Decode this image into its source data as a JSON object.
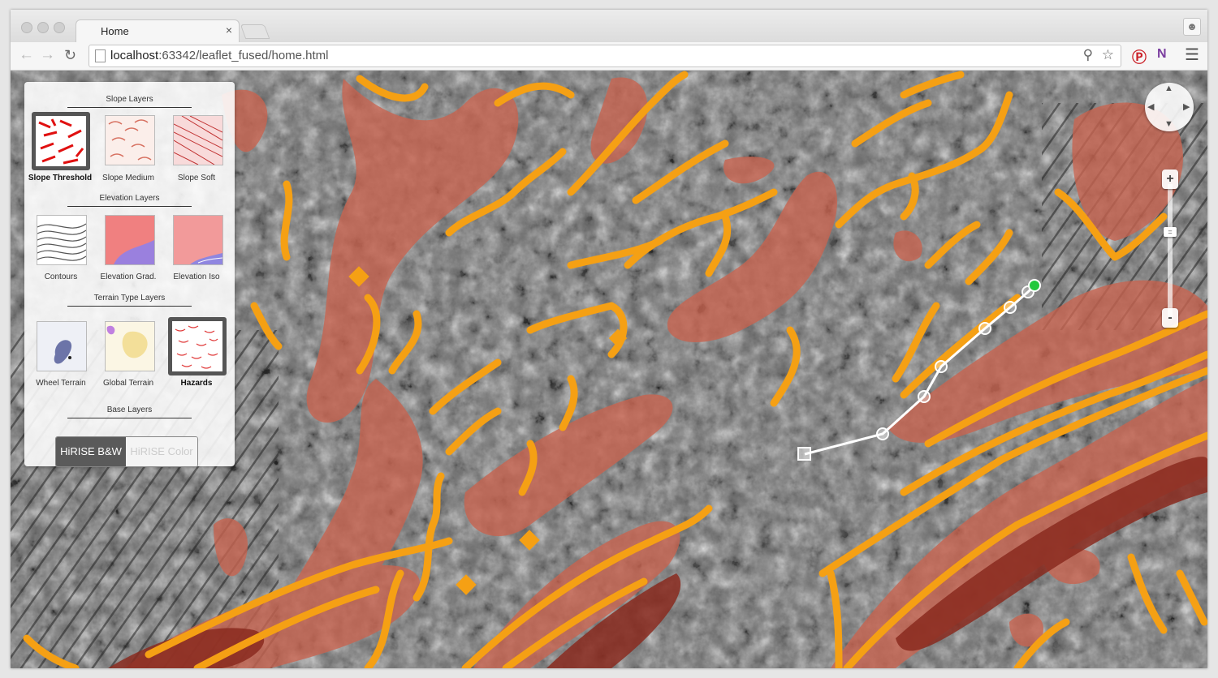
{
  "browser": {
    "tab_title": "Home",
    "tab_close": "×",
    "url_host": "localhost",
    "url_rest": ":63342/leaflet_fused/home.html"
  },
  "icons": {
    "back": "back-arrow-icon",
    "forward": "forward-arrow-icon",
    "reload": "reload-icon",
    "zoom_page": "magnifier-icon",
    "bookmark": "star-icon",
    "pinterest": "pinterest-icon",
    "onenote": "onenote-icon",
    "menu": "hamburger-menu-icon",
    "profile": "person-icon"
  },
  "layer_panel": {
    "sections": {
      "slope": "Slope Layers",
      "elevation": "Elevation Layers",
      "terrain": "Terrain Type Layers",
      "base": "Base Layers"
    },
    "slope_layers": [
      "Slope Threshold",
      "Slope Medium",
      "Slope Soft"
    ],
    "elevation_layers": [
      "Contours",
      "Elevation Grad.",
      "Elevation Iso"
    ],
    "terrain_layers": [
      "Wheel Terrain",
      "Global Terrain",
      "Hazards"
    ],
    "selected": [
      "Slope Threshold",
      "Hazards"
    ],
    "base_layers": {
      "active": "HiRISE B&W",
      "inactive": "HiRISE Color"
    }
  },
  "map_controls": {
    "zoom_in": "+",
    "zoom_out": "-",
    "zoom_knob": "="
  },
  "colors": {
    "hazard_orange": "#f5a014",
    "slope_red": "#c86450",
    "route_line": "#ffffff",
    "route_end": "#22c83c"
  }
}
